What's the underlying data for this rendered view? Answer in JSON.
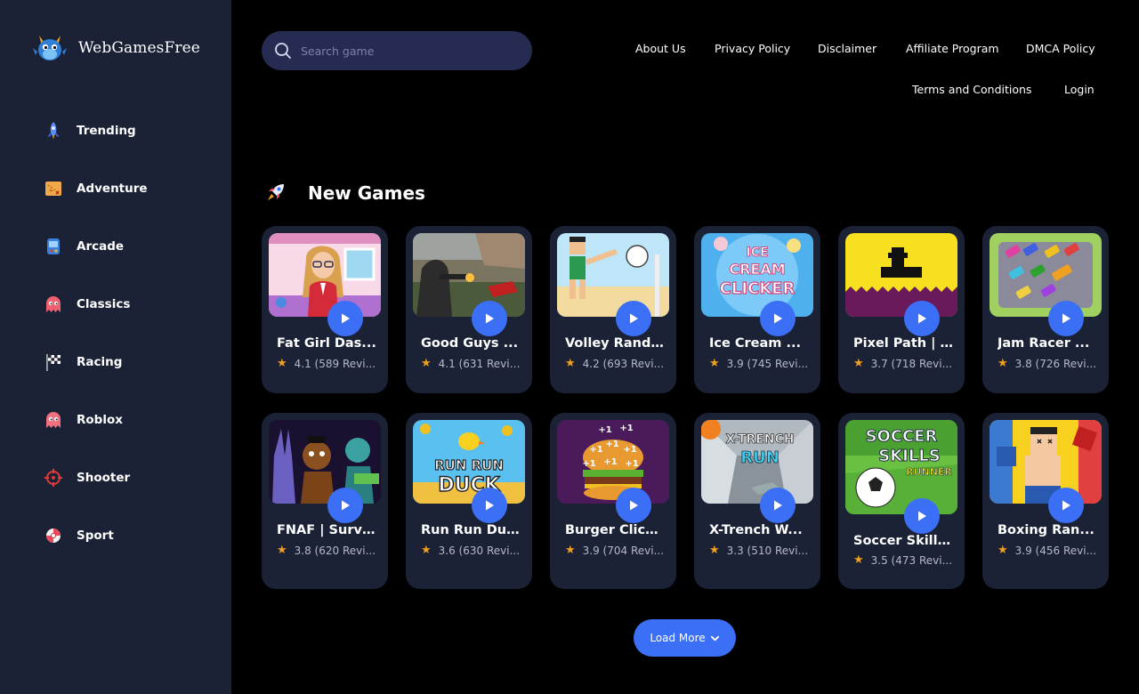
{
  "brand": {
    "name": "WebGamesFree"
  },
  "sidebar": {
    "items": [
      {
        "label": "Trending",
        "icon": "rocket-icon"
      },
      {
        "label": "Adventure",
        "icon": "treasure-map-icon"
      },
      {
        "label": "Arcade",
        "icon": "arcade-icon"
      },
      {
        "label": "Classics",
        "icon": "ghost-icon"
      },
      {
        "label": "Racing",
        "icon": "checkered-flag-icon"
      },
      {
        "label": "Roblox",
        "icon": "ghost-icon"
      },
      {
        "label": "Shooter",
        "icon": "crosshair-icon"
      },
      {
        "label": "Sport",
        "icon": "ball-icon"
      }
    ]
  },
  "search": {
    "placeholder": "Search game"
  },
  "topnav": {
    "about": "About Us",
    "privacy": "Privacy Policy",
    "disclaimer": "Disclaimer",
    "affiliate": "Affiliate Program",
    "dmca": "DMCA Policy",
    "terms": "Terms and Conditions",
    "login": "Login"
  },
  "section": {
    "title": "New Games"
  },
  "games": [
    {
      "title": "Fat Girl Das...",
      "rating": "4.1 (589 Revi..."
    },
    {
      "title": "Good Guys ...",
      "rating": "4.1 (631 Revie..."
    },
    {
      "title": "Volley Rand...",
      "rating": "4.2 (693 Revi..."
    },
    {
      "title": "Ice Cream ...",
      "rating": "3.9 (745 Revi..."
    },
    {
      "title": "Pixel Path | T...",
      "rating": "3.7 (718 Revi..."
    },
    {
      "title": "Jam Racer ...",
      "rating": "3.8 (726 Revi..."
    },
    {
      "title": "FNAF | Survi...",
      "rating": "3.8 (620 Revi..."
    },
    {
      "title": "Run Run Du...",
      "rating": "3.6 (630 Revi..."
    },
    {
      "title": "Burger Click...",
      "rating": "3.9 (704 Revi..."
    },
    {
      "title": "X-Trench W...",
      "rating": "3.3 (510 Revi..."
    },
    {
      "title": "Soccer Skills...",
      "rating": "3.5 (473 Revi..."
    },
    {
      "title": "Boxing Ran...",
      "rating": "3.9 (456 Revi..."
    }
  ],
  "thumb_text": {
    "ice_cream": [
      "ICE",
      "CREAM",
      "CLICKER"
    ],
    "run_duck": [
      "RUN RUN",
      "DUCK"
    ],
    "burger": "+1",
    "xtrench": [
      "X-TRENCH",
      "RUN"
    ],
    "soccer": [
      "SOCCER",
      "SKILLS",
      "RUNNER"
    ]
  },
  "load_more": {
    "label": "Load More"
  },
  "colors": {
    "accent": "#3b6ff5",
    "sidebar": "#1b2236",
    "card": "#1b2236",
    "background": "#000000",
    "star": "#f0a020"
  }
}
